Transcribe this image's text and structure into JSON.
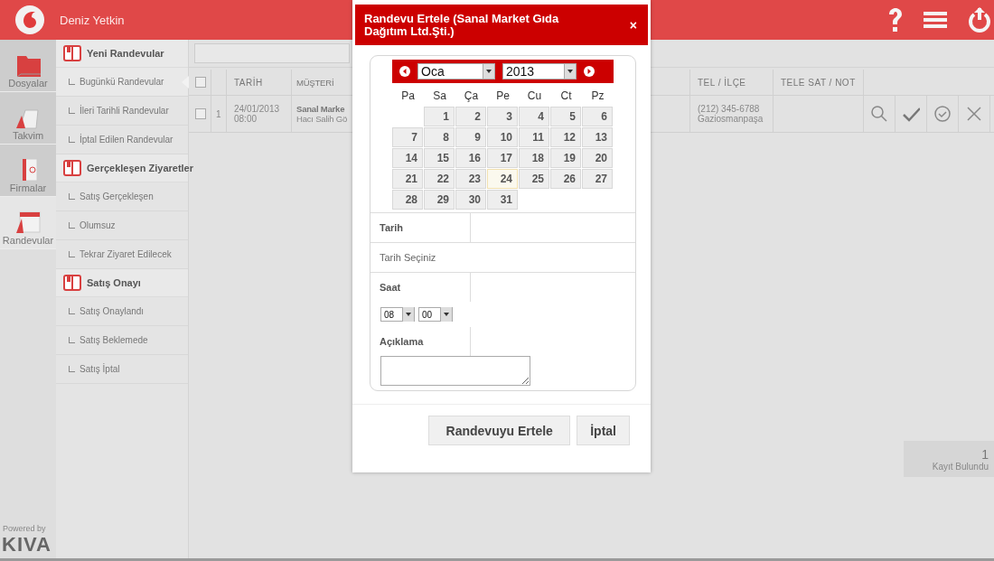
{
  "header": {
    "user": "Deniz Yetkin"
  },
  "rail": [
    {
      "label": "Dosyalar",
      "selected": false
    },
    {
      "label": "Takvim",
      "selected": false
    },
    {
      "label": "Firmalar",
      "selected": false
    },
    {
      "label": "Randevular",
      "selected": true
    }
  ],
  "menu": [
    {
      "label": "Yeni Randevular",
      "children": [
        {
          "label": "Bugünkü Randevular",
          "selected": true
        },
        {
          "label": "İleri Tarihli Randevular",
          "selected": false
        },
        {
          "label": "İptal Edilen Randevular",
          "selected": false
        }
      ]
    },
    {
      "label": "Gerçekleşen Ziyaretler",
      "children": [
        {
          "label": "Satış Gerçekleşen",
          "selected": false
        },
        {
          "label": "Olumsuz",
          "selected": false
        },
        {
          "label": "Tekrar Ziyaret Edilecek",
          "selected": false
        }
      ]
    },
    {
      "label": "Satış Onayı",
      "children": [
        {
          "label": "Satış Onaylandı",
          "selected": false
        },
        {
          "label": "Satış Beklemede",
          "selected": false
        },
        {
          "label": "Satış İptal",
          "selected": false
        }
      ]
    }
  ],
  "powered_by": "Powered by",
  "brand": "KIVA",
  "table": {
    "columns": [
      "TARİH",
      "MÜŞTERİ",
      "TEL / İLÇE",
      "TELE SAT / NOT"
    ],
    "select_all_checked": false,
    "rows": [
      {
        "checked": false,
        "index": "1",
        "date": "24/01/2013",
        "time": "08:00",
        "customer": "Sanal Marke",
        "contact": "Hacı Salih Gö",
        "phone": "(212) 345-6788",
        "district": "Gaziosmanpaşa"
      }
    ]
  },
  "result": {
    "count": "1",
    "label": "Kayıt Bulundu"
  },
  "dialog": {
    "title": "Randevu Ertele (Sanal Market Gıda Dağıtım Ltd.Şti.)",
    "close": "×",
    "calendar": {
      "month": "Oca",
      "year": "2013",
      "weekdays": [
        "Pa",
        "Sa",
        "Ça",
        "Pe",
        "Cu",
        "Ct",
        "Pz"
      ],
      "cells": [
        {
          "kind": "blank"
        },
        {
          "kind": "day",
          "label": "1",
          "today": false
        },
        {
          "kind": "day",
          "label": "2",
          "today": false
        },
        {
          "kind": "day",
          "label": "3",
          "today": false
        },
        {
          "kind": "day",
          "label": "4",
          "today": false
        },
        {
          "kind": "day",
          "label": "5",
          "today": false
        },
        {
          "kind": "day",
          "label": "6",
          "today": false
        },
        {
          "kind": "day",
          "label": "7",
          "today": false
        },
        {
          "kind": "day",
          "label": "8",
          "today": false
        },
        {
          "kind": "day",
          "label": "9",
          "today": false
        },
        {
          "kind": "day",
          "label": "10",
          "today": false
        },
        {
          "kind": "day",
          "label": "11",
          "today": false
        },
        {
          "kind": "day",
          "label": "12",
          "today": false
        },
        {
          "kind": "day",
          "label": "13",
          "today": false
        },
        {
          "kind": "day",
          "label": "14",
          "today": false
        },
        {
          "kind": "day",
          "label": "15",
          "today": false
        },
        {
          "kind": "day",
          "label": "16",
          "today": false
        },
        {
          "kind": "day",
          "label": "17",
          "today": false
        },
        {
          "kind": "day",
          "label": "18",
          "today": false
        },
        {
          "kind": "day",
          "label": "19",
          "today": false
        },
        {
          "kind": "day",
          "label": "20",
          "today": false
        },
        {
          "kind": "day",
          "label": "21",
          "today": false
        },
        {
          "kind": "day",
          "label": "22",
          "today": false
        },
        {
          "kind": "day",
          "label": "23",
          "today": false
        },
        {
          "kind": "day",
          "label": "24",
          "today": true
        },
        {
          "kind": "day",
          "label": "25",
          "today": false
        },
        {
          "kind": "day",
          "label": "26",
          "today": false
        },
        {
          "kind": "day",
          "label": "27",
          "today": false
        },
        {
          "kind": "day",
          "label": "28",
          "today": false
        },
        {
          "kind": "day",
          "label": "29",
          "today": false
        },
        {
          "kind": "day",
          "label": "30",
          "today": false
        },
        {
          "kind": "day",
          "label": "31",
          "today": false
        }
      ]
    },
    "date_label": "Tarih",
    "date_value": "Tarih Seçiniz",
    "time_label": "Saat",
    "hour": "08",
    "minute": "00",
    "note_label": "Açıklama",
    "buttons": [
      "Randevuyu Ertele",
      "İptal"
    ]
  }
}
